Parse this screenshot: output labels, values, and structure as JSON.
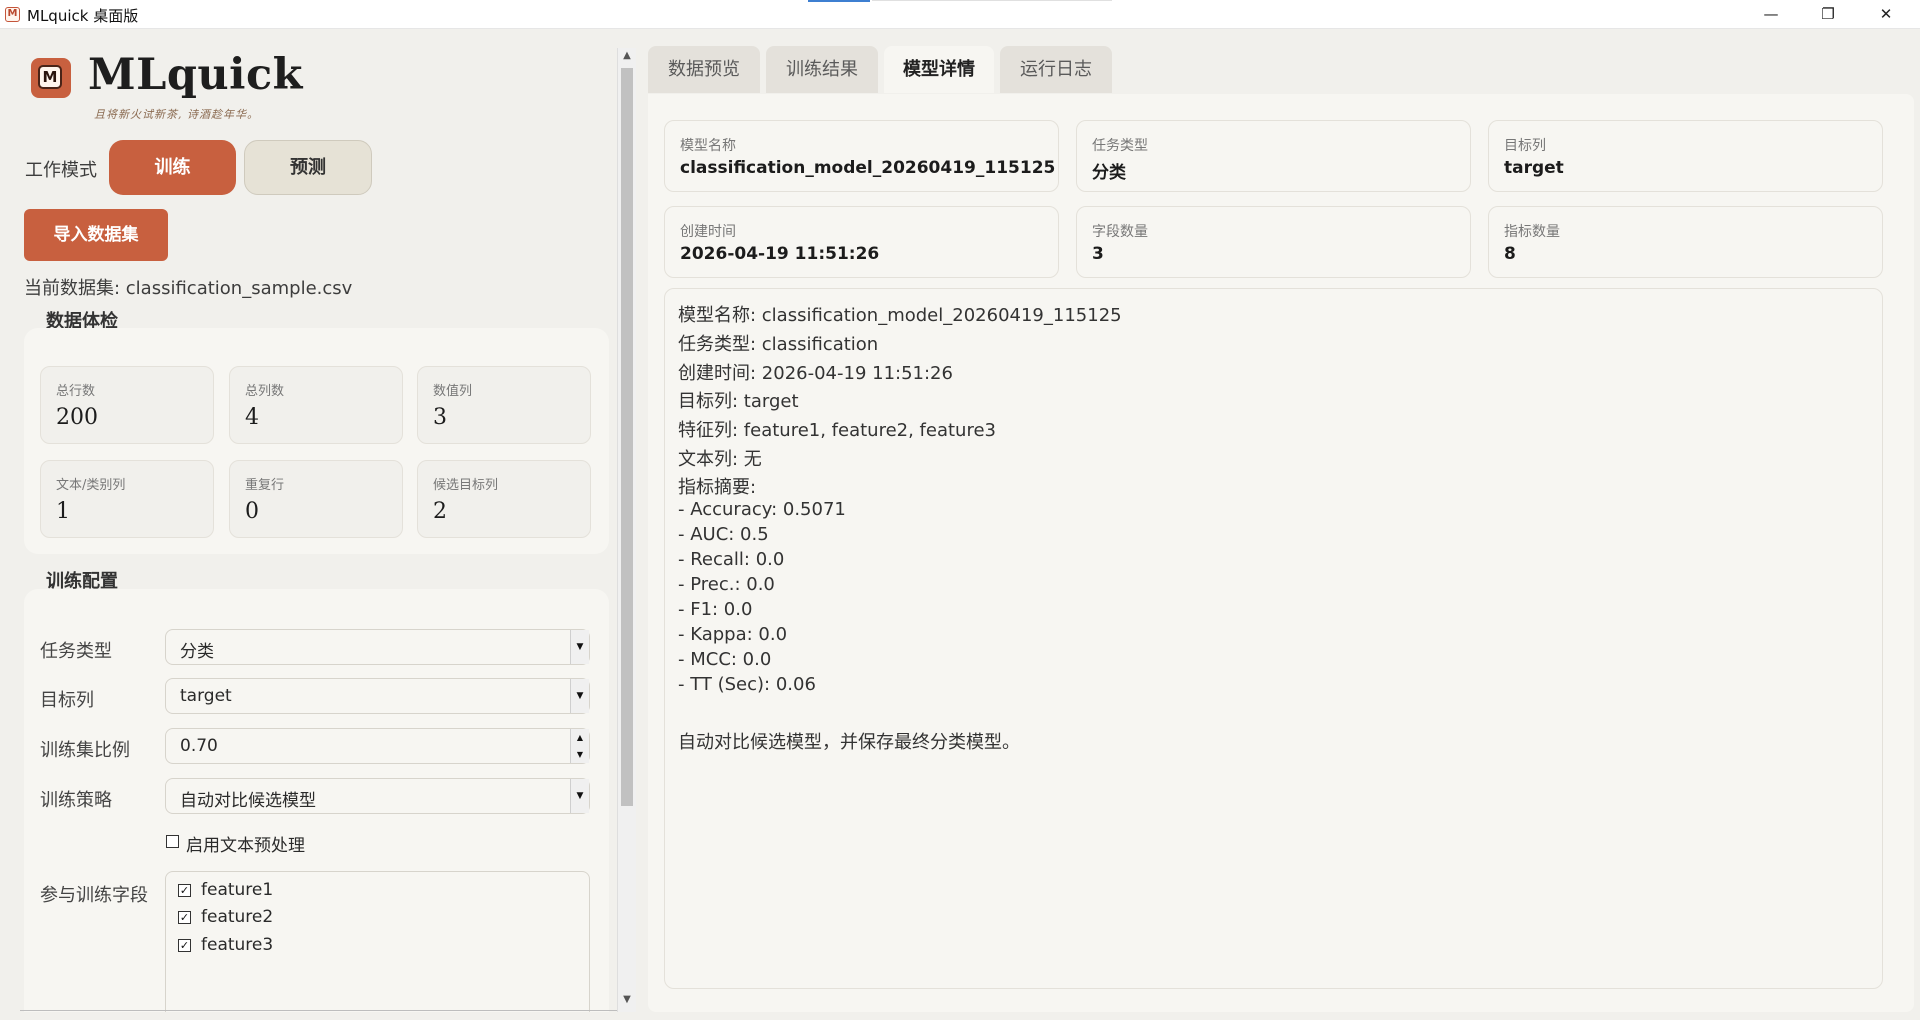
{
  "window": {
    "title": "MLquick 桌面版",
    "minimize": "—",
    "maximize": "❐",
    "close": "✕"
  },
  "brand": {
    "logo_letter": "M",
    "name": "MLquick",
    "slogan": "且将新火试新茶, 诗酒趁年华。"
  },
  "mode": {
    "label": "工作模式",
    "train_label": "训练",
    "predict_label": "预测",
    "selected": "训练"
  },
  "import_button": "导入数据集",
  "current_dataset": "当前数据集: classification_sample.csv",
  "data_check": {
    "title": "数据体检",
    "stats": [
      {
        "label": "总行数",
        "value": "200"
      },
      {
        "label": "总列数",
        "value": "4"
      },
      {
        "label": "数值列",
        "value": "3"
      },
      {
        "label": "文本/类别列",
        "value": "1"
      },
      {
        "label": "重复行",
        "value": "0"
      },
      {
        "label": "候选目标列",
        "value": "2"
      }
    ]
  },
  "train_config": {
    "title": "训练配置",
    "task_type": {
      "label": "任务类型",
      "value": "分类"
    },
    "target": {
      "label": "目标列",
      "value": "target"
    },
    "train_ratio": {
      "label": "训练集比例",
      "value": "0.70"
    },
    "strategy": {
      "label": "训练策略",
      "value": "自动对比候选模型"
    },
    "text_preprocess": {
      "label": "启用文本预处理",
      "checked": false
    },
    "fields": {
      "label": "参与训练字段",
      "items": [
        {
          "name": "feature1",
          "checked": true
        },
        {
          "name": "feature2",
          "checked": true
        },
        {
          "name": "feature3",
          "checked": true
        }
      ]
    }
  },
  "tabs": [
    {
      "label": "数据预览",
      "active": false
    },
    {
      "label": "训练结果",
      "active": false
    },
    {
      "label": "模型详情",
      "active": true
    },
    {
      "label": "运行日志",
      "active": false
    }
  ],
  "model_info": [
    {
      "label": "模型名称",
      "value": "classification_model_20260419_115125"
    },
    {
      "label": "任务类型",
      "value": "分类"
    },
    {
      "label": "目标列",
      "value": "target"
    },
    {
      "label": "创建时间",
      "value": "2026-04-19 11:51:26"
    },
    {
      "label": "字段数量",
      "value": "3"
    },
    {
      "label": "指标数量",
      "value": "8"
    }
  ],
  "details": [
    "模型名称: classification_model_20260419_115125",
    "任务类型: classification",
    "创建时间: 2026-04-19 11:51:26",
    "目标列: target",
    "特征列: feature1, feature2, feature3",
    "文本列: 无",
    "指标摘要:",
    "- Accuracy: 0.5071",
    "- AUC: 0.5",
    "- Recall: 0.0",
    "- Prec.: 0.0",
    "- F1: 0.0",
    "- Kappa: 0.0",
    "- MCC: 0.0",
    "- TT (Sec): 0.06",
    "",
    "自动对比候选模型，并保存最终分类模型。"
  ],
  "colors": {
    "accent": "#c8603f",
    "background": "#f1f0ec",
    "card": "#f7f6f2"
  }
}
